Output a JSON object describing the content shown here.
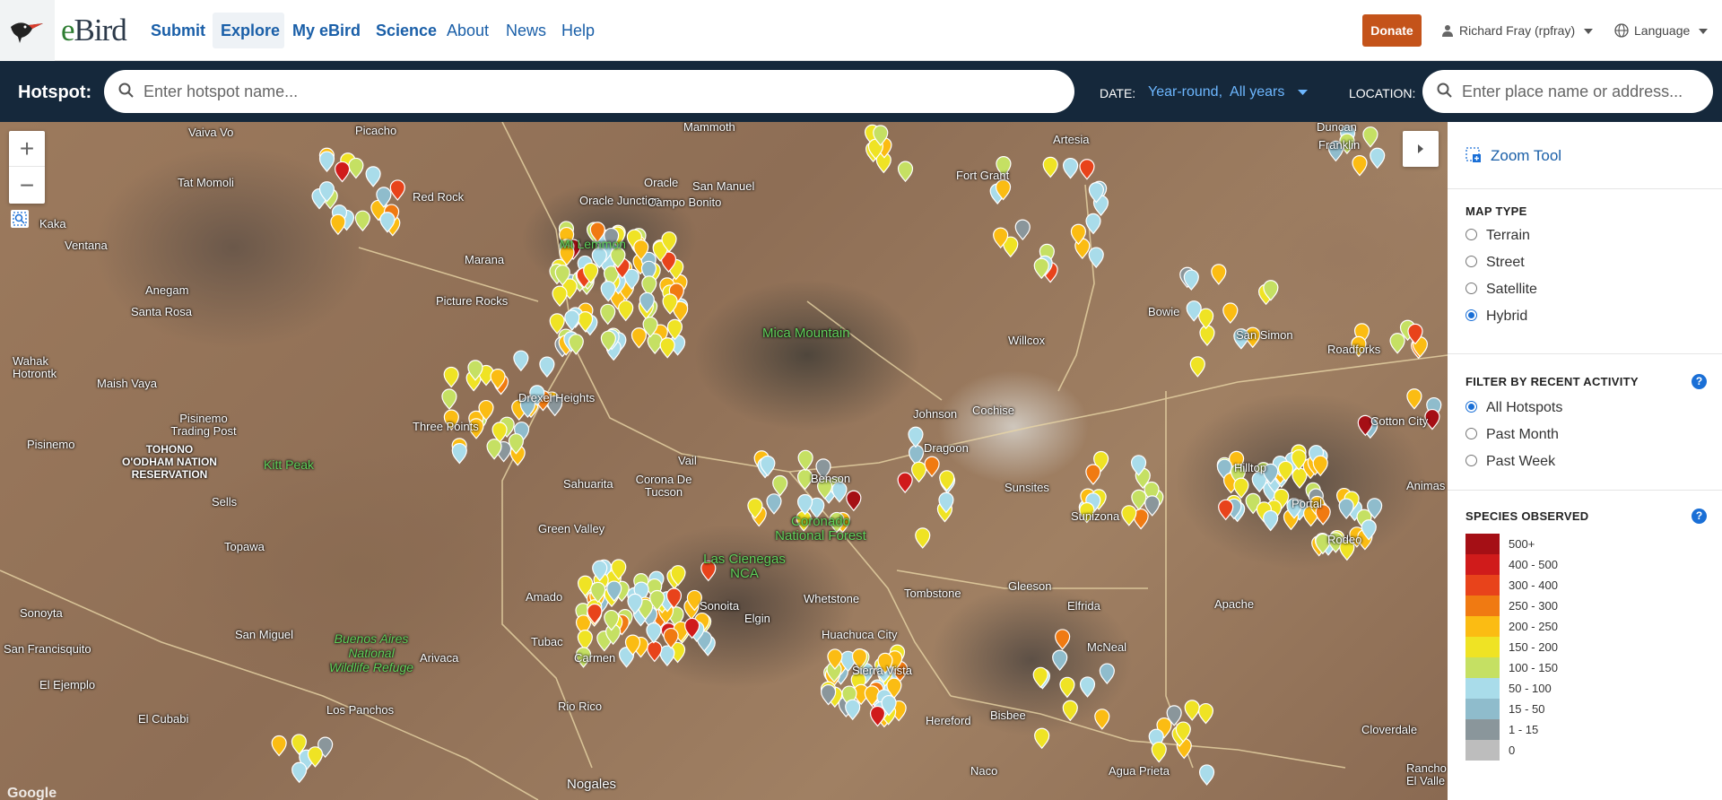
{
  "brand": {
    "logo_text_e": "e",
    "logo_text_rest": "Bird"
  },
  "nav": {
    "submit": "Submit",
    "explore": "Explore",
    "my_ebird": "My eBird",
    "science": "Science",
    "about": "About",
    "news": "News",
    "help": "Help",
    "donate": "Donate",
    "user": "Richard Fray (rpfray)",
    "language": "Language"
  },
  "search": {
    "hotspot_label": "Hotspot:",
    "hotspot_placeholder": "Enter hotspot name...",
    "date_label": "DATE:",
    "date_value": "Year-round,  All years",
    "location_label": "LOCATION:",
    "location_placeholder": "Enter place name or address..."
  },
  "map": {
    "zoom_in": "+",
    "zoom_out": "−",
    "attribution": "Google",
    "places": [
      "Vaiva Vo",
      "Picacho",
      "Mammoth",
      "Artesia",
      "Tat Momoli",
      "Oracle",
      "San Manuel",
      "Fort Grant",
      "Red Rock",
      "Oracle Junction",
      "Campo Bonito",
      "Kaka",
      "Ventana",
      "Marana",
      "Mt Lemmon",
      "Anegam",
      "Santa Rosa",
      "Picture Rocks",
      "Bowie",
      "San Simon",
      "Roadforks",
      "Mica Mountain",
      "Willcox",
      "Wahak Hotrontk",
      "Maish Vaya",
      "Drexel Heights",
      "Pisinemo Trading Post",
      "Three Points",
      "Johnson",
      "Cochise",
      "Cotton City",
      "Pisinemo",
      "TOHONO O'ODHAM NATION RESERVATION",
      "Vail",
      "Benson",
      "Dragoon",
      "Kitt Peak",
      "Sahuarita",
      "Corona De Tucson",
      "Sunsites",
      "Animas",
      "Sells",
      "Sunizona",
      "Hilltop",
      "Portal",
      "Green Valley",
      "Coronado National Forest",
      "Rodeo",
      "Topawa",
      "Las Cienegas NCA",
      "Gleeson",
      "Whetstone",
      "Tombstone",
      "Apache",
      "Sonoyta",
      "Amado",
      "Elgin",
      "Elfrida",
      "San Miguel",
      "Sonoita",
      "Huachuca City",
      "Buenos Aires National Wildlife Refuge",
      "Arivaca",
      "Tubac",
      "Carmen",
      "McNeal",
      "San Francisquito",
      "Sierra Vista",
      "El Ejemplo",
      "Rio Rico",
      "Bisbee",
      "Cloverdale",
      "El Cubabi",
      "Los Panchos",
      "Hereford",
      "Naco",
      "Agua Prieta",
      "Rancho El Valle",
      "Nogales",
      "Duncan",
      "Franklin"
    ]
  },
  "panel": {
    "zoom_tool": "Zoom Tool",
    "map_type_title": "MAP TYPE",
    "map_types": [
      "Terrain",
      "Street",
      "Satellite",
      "Hybrid"
    ],
    "map_type_selected": "Hybrid",
    "filter_title": "FILTER BY RECENT ACTIVITY",
    "filters": [
      "All Hotspots",
      "Past Month",
      "Past Week"
    ],
    "filter_selected": "All Hotspots",
    "species_title": "SPECIES OBSERVED",
    "legend": [
      {
        "label": "500+",
        "color": "#a50f15"
      },
      {
        "label": "400 - 500",
        "color": "#d01b1b"
      },
      {
        "label": "300 - 400",
        "color": "#e8431b"
      },
      {
        "label": "250 - 300",
        "color": "#f07a12"
      },
      {
        "label": "200 - 250",
        "color": "#fbbc13"
      },
      {
        "label": "150 - 200",
        "color": "#efe324"
      },
      {
        "label": "100 - 150",
        "color": "#c5e063"
      },
      {
        "label": "50 - 100",
        "color": "#a9dcea"
      },
      {
        "label": "15 - 50",
        "color": "#8fbccc"
      },
      {
        "label": "1 - 15",
        "color": "#8a969b"
      },
      {
        "label": "0",
        "color": "#bdbdbd"
      }
    ]
  }
}
